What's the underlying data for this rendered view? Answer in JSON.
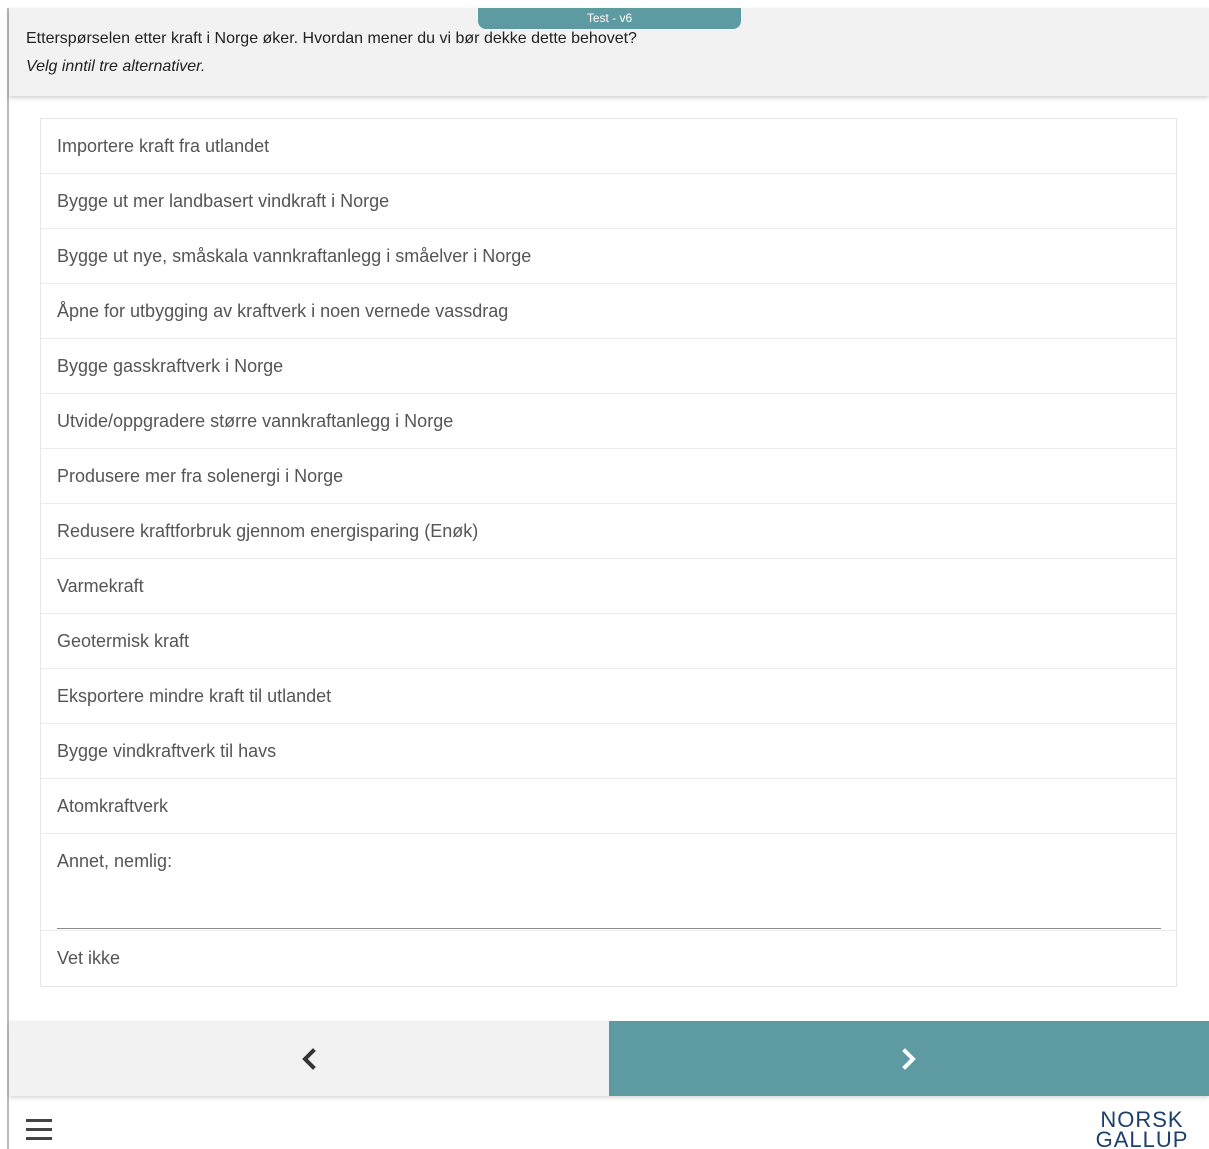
{
  "header": {
    "version_label": "Test - v6",
    "question": "Etterspørselen etter kraft i Norge øker. Hvordan mener du vi bør dekke dette behovet?",
    "instruction": "Velg inntil tre alternativer."
  },
  "options": [
    "Importere kraft fra utlandet",
    "Bygge ut mer landbasert vindkraft i Norge",
    "Bygge ut nye, småskala vannkraftanlegg i småelver i Norge",
    "Åpne for utbygging av kraftverk i noen vernede vassdrag",
    "Bygge gasskraftverk i Norge",
    "Utvide/oppgradere større vannkraftanlegg i Norge",
    "Produsere mer fra solenergi i Norge",
    "Redusere kraftforbruk gjennom energisparing (Enøk)",
    "Varmekraft",
    "Geotermisk kraft",
    "Eksportere mindre kraft til utlandet",
    "Bygge vindkraftverk til havs",
    "Atomkraftverk"
  ],
  "other_option": {
    "label": "Annet, nemlig:",
    "value": "",
    "placeholder": ""
  },
  "dont_know": "Vet ikke",
  "navigation": {
    "back_icon": "chevron-left-icon",
    "next_icon": "chevron-right-icon"
  },
  "footer": {
    "menu_icon": "hamburger-menu-icon",
    "logo_line1": "NORSK",
    "logo_line2": "GALLUP"
  },
  "colors": {
    "accent": "#5e9aa1",
    "header_bg": "#f2f2f2",
    "text": "#555555",
    "logo": "#1d3f6e"
  }
}
